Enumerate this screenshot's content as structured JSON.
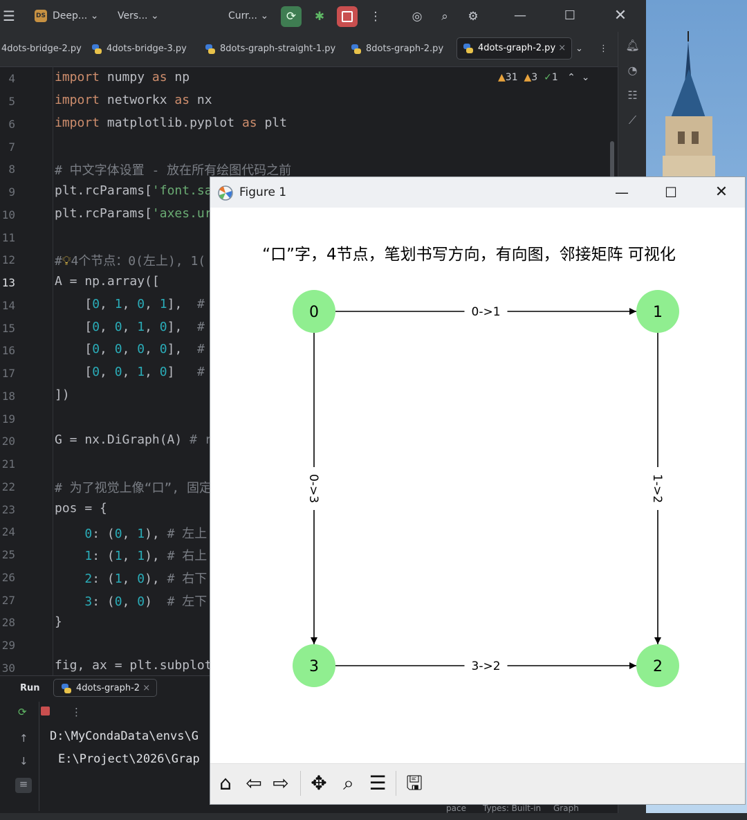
{
  "ide": {
    "titlebar": {
      "project_badge": "DS",
      "project": "Deep...",
      "vcs": "Vers...",
      "run_config": "Curr..."
    },
    "tabs": [
      {
        "label": "4dots-bridge-2.py"
      },
      {
        "label": "4dots-bridge-3.py"
      },
      {
        "label": "8dots-graph-straight-1.py"
      },
      {
        "label": "8dots-graph-2.py"
      },
      {
        "label": "4dots-graph-2.py",
        "active": true
      }
    ],
    "inspections": {
      "warnings": "31",
      "weak_warnings": "3",
      "ok": "1"
    },
    "line_numbers": [
      "4",
      "5",
      "6",
      "7",
      "8",
      "9",
      "10",
      "11",
      "12",
      "13",
      "14",
      "15",
      "16",
      "17",
      "18",
      "19",
      "20",
      "21",
      "22",
      "23",
      "24",
      "25",
      "26",
      "27",
      "28",
      "29",
      "30"
    ],
    "current_line": "13",
    "run_panel": {
      "title": "Run",
      "tab": "4dots-graph-2",
      "output": [
        "D:\\MyCondaData\\envs\\G",
        "E:\\Project\\2026\\Grap"
      ]
    },
    "status_fragments": [
      "pace",
      "Types: Built-in",
      "Graph"
    ]
  },
  "figure": {
    "window_title": "Figure 1",
    "chart_data": {
      "type": "directed-graph",
      "title": "“口”字，4节点，笔划书写方向，有向图，邻接矩阵 可视化",
      "node_color": "#90ee90",
      "nodes": [
        {
          "id": "0",
          "pos": [
            0,
            1
          ]
        },
        {
          "id": "1",
          "pos": [
            1,
            1
          ]
        },
        {
          "id": "2",
          "pos": [
            1,
            0
          ]
        },
        {
          "id": "3",
          "pos": [
            0,
            0
          ]
        }
      ],
      "edges": [
        {
          "from": "0",
          "to": "1",
          "label": "0->1"
        },
        {
          "from": "1",
          "to": "2",
          "label": "1->2"
        },
        {
          "from": "0",
          "to": "3",
          "label": "0->3"
        },
        {
          "from": "3",
          "to": "2",
          "label": "3->2"
        }
      ]
    },
    "toolbar": [
      "home-icon",
      "back-icon",
      "forward-icon",
      "pan-icon",
      "zoom-icon",
      "configure-icon",
      "save-icon"
    ]
  }
}
